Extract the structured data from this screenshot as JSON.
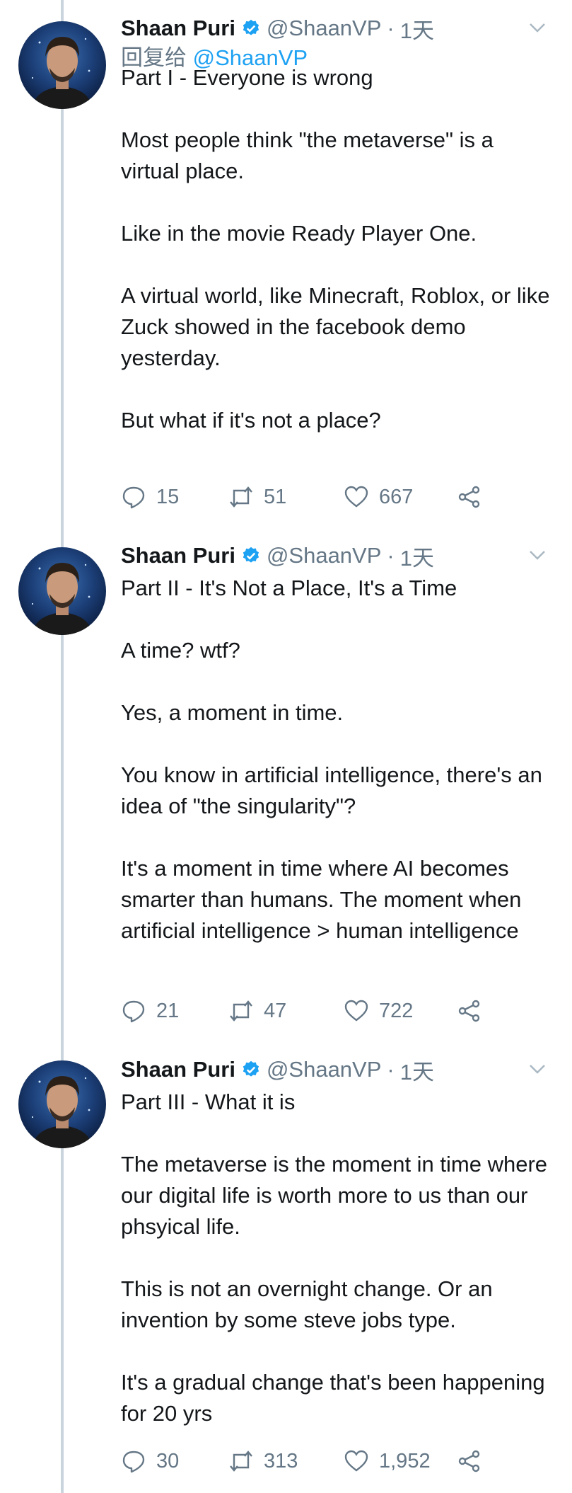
{
  "tweets": [
    {
      "author": "Shaan Puri",
      "handle": "@ShaanVP",
      "separator": "·",
      "time": "1天",
      "reply_prefix": "回复给",
      "reply_to": "@ShaanVP",
      "paragraphs": [
        "Part I - Everyone is wrong",
        "Most people think \"the metaverse\" is a virtual place.",
        "Like in the movie Ready Player One.",
        "A virtual world, like Minecraft, Roblox, or like Zuck showed in the facebook demo yesterday.",
        "But what if it's not a place?"
      ],
      "replies": "15",
      "retweets": "51",
      "likes": "667"
    },
    {
      "author": "Shaan Puri",
      "handle": "@ShaanVP",
      "separator": "·",
      "time": "1天",
      "paragraphs": [
        "Part II - It's Not a Place, It's a Time",
        "A time? wtf?",
        "Yes, a moment in time.",
        "You know in artificial intelligence, there's an idea of \"the singularity\"?",
        "It's a moment in time where AI becomes smarter than humans. The moment when artificial intelligence > human intelligence"
      ],
      "replies": "21",
      "retweets": "47",
      "likes": "722"
    },
    {
      "author": "Shaan Puri",
      "handle": "@ShaanVP",
      "separator": "·",
      "time": "1天",
      "paragraphs": [
        "Part III - What it is",
        "The metaverse is the moment in time where our digital life is worth more to us than our phsyical life.",
        "This is not an overnight change. Or an invention by some steve jobs type.",
        "It's a gradual change that's been happening for 20 yrs"
      ],
      "replies": "30",
      "retweets": "313",
      "likes": "1,952"
    }
  ],
  "icons": {
    "verified": "verified-badge-icon",
    "chevron": "chevron-down-icon",
    "reply": "reply-icon",
    "retweet": "retweet-icon",
    "like": "heart-icon",
    "share": "share-icon"
  },
  "colors": {
    "link": "#1da1f2",
    "muted": "#657786",
    "text": "#14171a",
    "thread_line": "#c9d4dd"
  }
}
